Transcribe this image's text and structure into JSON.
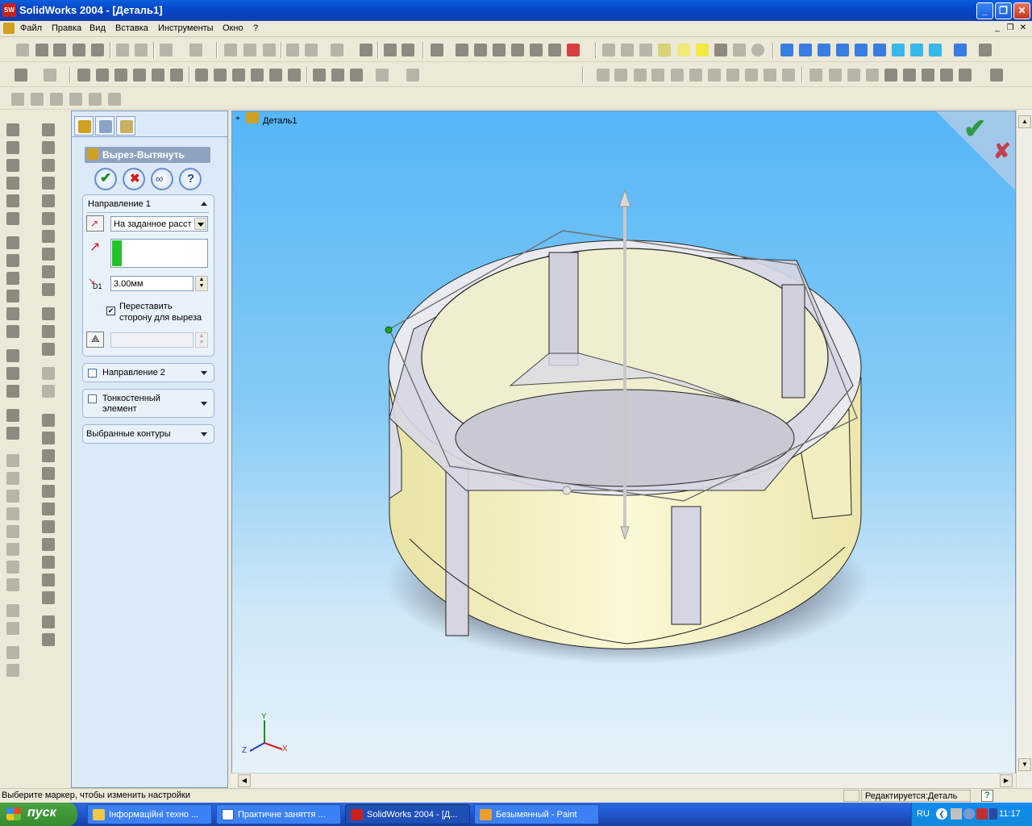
{
  "window": {
    "title": "SolidWorks 2004 - [Деталь1]",
    "logo": "SW"
  },
  "menu": {
    "items": [
      "Файл",
      "Правка",
      "Вид",
      "Вставка",
      "Инструменты",
      "Окно",
      "?"
    ]
  },
  "property_manager": {
    "feature_title": "Вырез-Вытянуть",
    "direction1": {
      "header": "Направление 1",
      "end_condition": "На заданное расст",
      "depth": "3.00мм",
      "depth_label": "D1",
      "flip_side_checked": true,
      "flip_side_label_line1": "Переставить",
      "flip_side_label_line2": "сторону для выреза"
    },
    "direction2": {
      "header": "Направление 2"
    },
    "thin": {
      "line1": "Тонкостенный",
      "line2": "элемент"
    },
    "selected_contours": "Выбранные контуры"
  },
  "feature_tree": {
    "root": "Деталь1"
  },
  "triad": {
    "x": "X",
    "y": "Y",
    "z": "Z"
  },
  "status": {
    "message": "Выберите маркер, чтобы изменить настройки",
    "editing": "Редактируется:Деталь"
  },
  "taskbar": {
    "start": "пуск",
    "tasks": [
      "Інформаційні техно ...",
      "Практичне заняття ...",
      "SolidWorks 2004 - [Д...",
      "Безымянный - Paint"
    ],
    "lang": "RU",
    "time": "11:17"
  },
  "colors": {
    "viewport_top": "#55b6f7",
    "part_yellow": "#f5f2c0",
    "part_gray": "#d7d7e4",
    "accept_green": "#2e9a44",
    "cancel_red": "#c44050"
  }
}
